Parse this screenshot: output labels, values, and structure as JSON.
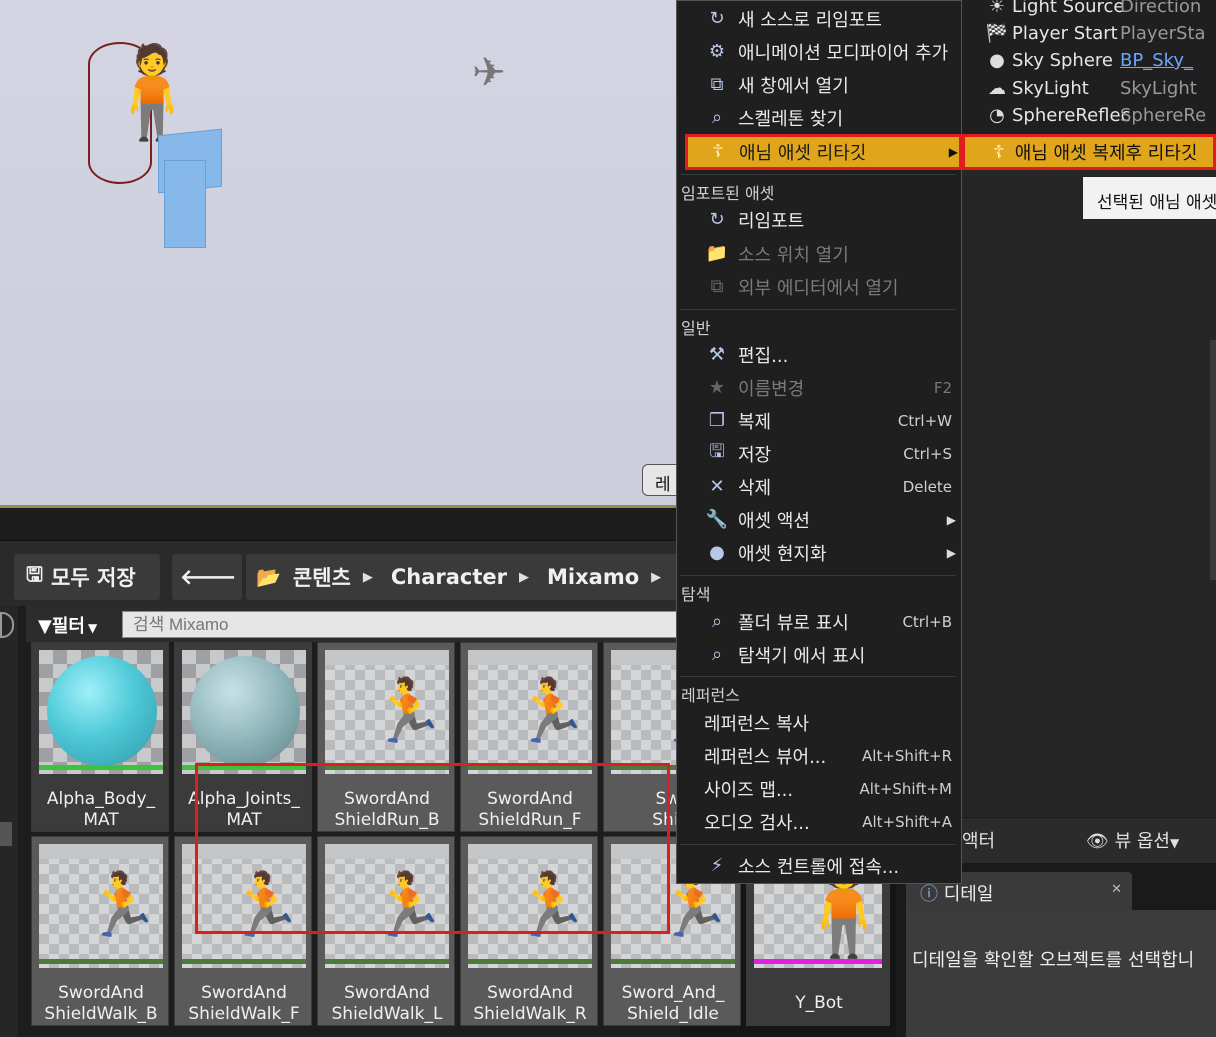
{
  "viewport": {
    "button_partial": "레"
  },
  "toolbar": {
    "save_all": "모두 저장",
    "path": [
      "콘텐츠",
      "Character",
      "Mixamo"
    ],
    "filter": "필터",
    "search_placeholder": "검색 Mixamo"
  },
  "assets": [
    {
      "label": "Alpha_Body_\nMAT",
      "kind": "material",
      "bar_color": "#3ec23e"
    },
    {
      "label": "Alpha_Joints_\nMAT",
      "kind": "material",
      "bar_color": "#3ec23e"
    },
    {
      "label": "SwordAnd\nShieldRun_B",
      "kind": "anim"
    },
    {
      "label": "SwordAnd\nShieldRun_F",
      "kind": "anim"
    },
    {
      "label": "Swo\nShiel",
      "kind": "anim"
    },
    {
      "label": "SwordAnd\nShieldWalk_B",
      "kind": "anim"
    },
    {
      "label": "SwordAnd\nShieldWalk_F",
      "kind": "anim"
    },
    {
      "label": "SwordAnd\nShieldWalk_L",
      "kind": "anim"
    },
    {
      "label": "SwordAnd\nShieldWalk_R",
      "kind": "anim"
    },
    {
      "label": "Sword_And_\nShield_Idle",
      "kind": "anim"
    },
    {
      "label": "Y_Bot",
      "kind": "skeletal",
      "bar_color": "#e020e0"
    }
  ],
  "context_menu": {
    "items_top": [
      {
        "label": "새 소스로 리임포트",
        "icon": "reimport-icon"
      },
      {
        "label": "애니메이션 모디파이어 추가",
        "icon": "modifier-icon"
      },
      {
        "label": "새 창에서 열기",
        "icon": "open-window-icon"
      },
      {
        "label": "스켈레톤 찾기",
        "icon": "find-skeleton-icon"
      },
      {
        "label": "애님 애셋 리타깃",
        "icon": "retarget-icon"
      }
    ],
    "section_imported": "임포트된 애셋",
    "items_imported": [
      {
        "label": "리임포트",
        "icon": "reimport-icon"
      },
      {
        "label": "소스 위치 열기",
        "icon": "source-location-icon"
      },
      {
        "label": "외부 에디터에서 열기",
        "icon": "external-editor-icon"
      }
    ],
    "section_general": "일반",
    "items_general": [
      {
        "label": "편집...",
        "icon": "edit-icon"
      },
      {
        "label": "이름변경",
        "icon": "rename-icon",
        "shortcut": "F2"
      },
      {
        "label": "복제",
        "icon": "duplicate-icon",
        "shortcut": "Ctrl+W"
      },
      {
        "label": "저장",
        "icon": "save-icon",
        "shortcut": "Ctrl+S"
      },
      {
        "label": "삭제",
        "icon": "delete-icon",
        "shortcut": "Delete"
      },
      {
        "label": "애셋 액션",
        "icon": "wrench-icon"
      },
      {
        "label": "애셋 현지화",
        "icon": "globe-icon"
      }
    ],
    "section_browse": "탐색",
    "items_browse": [
      {
        "label": "폴더 뷰로 표시",
        "icon": "magnifier-icon",
        "shortcut": "Ctrl+B"
      },
      {
        "label": "탐색기 에서 표시",
        "icon": "magnifier-icon"
      }
    ],
    "section_references": "레퍼런스",
    "items_references": [
      {
        "label": "레퍼런스 복사"
      },
      {
        "label": "레퍼런스 뷰어...",
        "shortcut": "Alt+Shift+R"
      },
      {
        "label": "사이즈 맵...",
        "shortcut": "Alt+Shift+M"
      },
      {
        "label": "오디오 검사...",
        "shortcut": "Alt+Shift+A"
      }
    ],
    "source_control": "소스 컨트롤에 접속..."
  },
  "submenu": {
    "label": "애님 애셋 복제후 리타깃",
    "tooltip": "선택된 애님 애셋을"
  },
  "outliner": {
    "rows": [
      {
        "name": "Light Source",
        "type": "Direction",
        "link": false
      },
      {
        "name": "Player Start",
        "type": "PlayerSta",
        "link": false
      },
      {
        "name": "Sky Sphere",
        "type": "BP_Sky_",
        "link": true
      },
      {
        "name": "SkyLight",
        "type": "SkyLight",
        "link": false
      },
      {
        "name": "SphereReflec",
        "type": "SphereRe",
        "link": false
      }
    ],
    "actor_label": "액터",
    "view_options": "뷰 옵션"
  },
  "details": {
    "tab": "디테일",
    "message": "디테일을 확인할 오브젝트를 선택합니"
  }
}
